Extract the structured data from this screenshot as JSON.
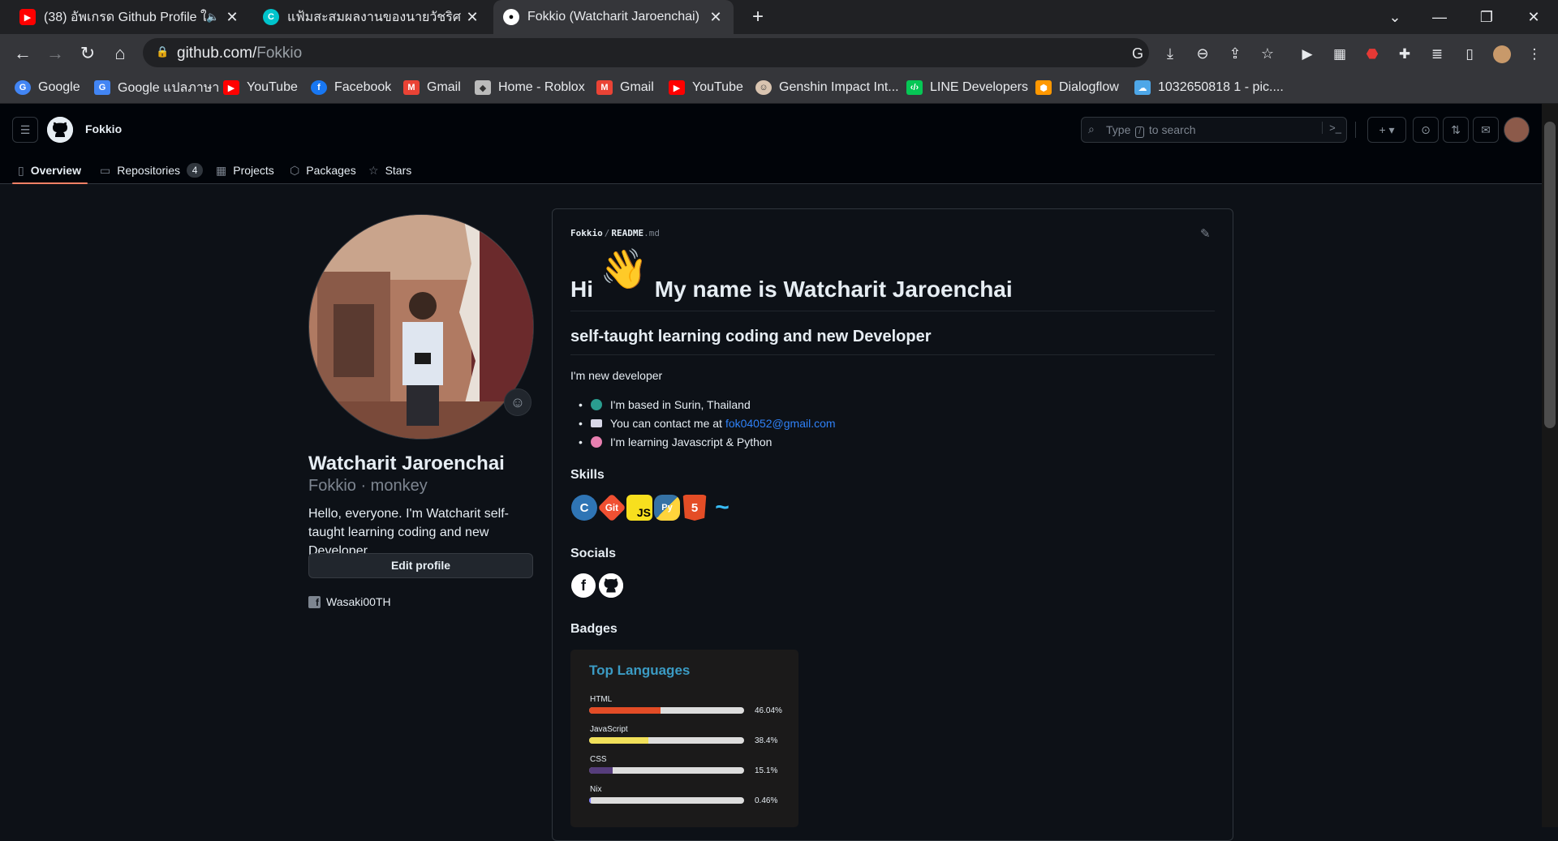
{
  "browser": {
    "tabs": [
      {
        "title": "(38) อัพเกรด Github Profile ให้",
        "favicon": "youtube-icon",
        "color": "#ff0000",
        "muted": true
      },
      {
        "title": "แฟ้มสะสมผลงานของนายวัชริศ เจริญชัย",
        "favicon": "canva-icon",
        "color": "#00c4cc"
      },
      {
        "title": "Fokkio (Watcharit Jaroenchai)",
        "favicon": "github-icon",
        "color": "#ffffff",
        "active": true
      }
    ],
    "url_host": "github.com/",
    "url_path": "Fokkio",
    "bookmarks": [
      {
        "label": "Google",
        "icon": "google-icon",
        "color": "#4285f4"
      },
      {
        "label": "Google แปลภาษา",
        "icon": "translate-icon",
        "color": "#4285f4"
      },
      {
        "label": "YouTube",
        "icon": "youtube-icon",
        "color": "#ff0000"
      },
      {
        "label": "Facebook",
        "icon": "facebook-icon",
        "color": "#1877f2"
      },
      {
        "label": "Gmail",
        "icon": "gmail-icon",
        "color": "#ea4335"
      },
      {
        "label": "Home - Roblox",
        "icon": "roblox-icon",
        "color": "#bbbbbb"
      },
      {
        "label": "Gmail",
        "icon": "gmail-icon",
        "color": "#ea4335"
      },
      {
        "label": "YouTube",
        "icon": "youtube-icon",
        "color": "#ff0000"
      },
      {
        "label": "Genshin Impact Int...",
        "icon": "genshin-icon",
        "color": "#d9c4b0"
      },
      {
        "label": "LINE Developers",
        "icon": "line-icon",
        "color": "#06c755"
      },
      {
        "label": "Dialogflow",
        "icon": "dialogflow-icon",
        "color": "#ff9800"
      },
      {
        "label": "1032650818 1 - pic....",
        "icon": "image-icon",
        "color": "#4ea7e8"
      }
    ]
  },
  "github": {
    "header_user": "Fokkio",
    "search_placeholder_pre": "Type",
    "search_key": "/",
    "search_placeholder_post": "to search",
    "tabs": [
      {
        "label": "Overview",
        "icon": "book-icon",
        "selected": true
      },
      {
        "label": "Repositories",
        "icon": "repo-icon",
        "count": "4"
      },
      {
        "label": "Projects",
        "icon": "table-icon"
      },
      {
        "label": "Packages",
        "icon": "package-icon"
      },
      {
        "label": "Stars",
        "icon": "star-icon"
      }
    ]
  },
  "profile": {
    "full_name": "Watcharit Jaroenchai",
    "username_line": "Fokkio · monkey",
    "bio": "Hello, everyone. I'm Watcharit self-taught learning coding and new Developer",
    "edit_label": "Edit profile",
    "facebook_handle": "Wasaki00TH"
  },
  "readme": {
    "crumb_user": "Fokkio",
    "crumb_file": "README",
    "crumb_ext": ".md",
    "h1_pre": "Hi",
    "h1_post": "My name is Watcharit Jaroenchai",
    "h2": "self-taught learning coding and new Developer",
    "intro": "I'm new developer",
    "bullets": [
      {
        "text": "I'm based in Surin, Thailand",
        "icon": "globe-icon",
        "color": "#2a9d8f"
      },
      {
        "text": "You can contact me at",
        "link": "fok04052@gmail.com",
        "icon": "mail-icon",
        "color": "#d8d8e8"
      },
      {
        "text": "I'm learning Javascript & Python",
        "icon": "brain-icon",
        "color": "#e77fb0"
      }
    ],
    "skills_title": "Skills",
    "skills": [
      {
        "name": "C",
        "icon": "c-icon",
        "bg": "#2f75b5",
        "fg": "#ffffff"
      },
      {
        "name": "Git",
        "icon": "git-icon",
        "bg": "#f05032",
        "fg": "#ffffff"
      },
      {
        "name": "JS",
        "icon": "javascript-icon",
        "bg": "#f7df1e",
        "fg": "#000000"
      },
      {
        "name": "Py",
        "icon": "python-icon",
        "bg": "#3572a5",
        "fg": "#ffd43b"
      },
      {
        "name": "5",
        "icon": "html5-icon",
        "bg": "#e44d26",
        "fg": "#ffffff"
      },
      {
        "name": "~",
        "icon": "tailwind-icon",
        "bg": "#0d1117",
        "fg": "#38bdf8"
      }
    ],
    "socials_title": "Socials",
    "socials": [
      {
        "name": "f",
        "icon": "facebook-icon"
      },
      {
        "name": "gh",
        "icon": "github-icon"
      }
    ],
    "badges_title": "Badges",
    "top_languages": {
      "title": "Top Languages",
      "languages": [
        {
          "name": "HTML",
          "percent": "46.04%",
          "value": 46.04,
          "color": "#e34c26"
        },
        {
          "name": "JavaScript",
          "percent": "38.4%",
          "value": 38.4,
          "color": "#f1e05a"
        },
        {
          "name": "CSS",
          "percent": "15.1%",
          "value": 15.1,
          "color": "#563d7c"
        },
        {
          "name": "Nix",
          "percent": "0.46%",
          "value": 0.46,
          "color": "#7e7eff"
        }
      ]
    }
  }
}
